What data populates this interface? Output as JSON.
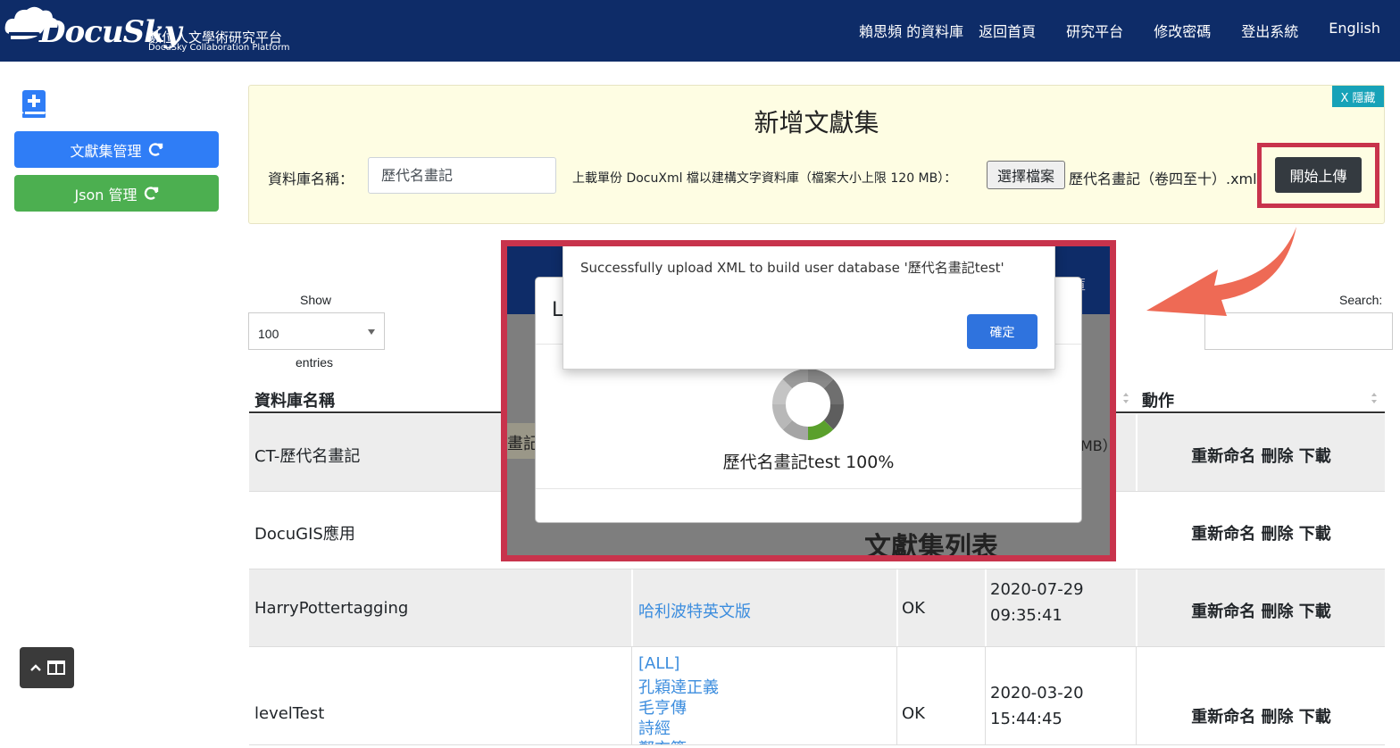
{
  "brand": {
    "logo_word": "DocuSky",
    "subtitle_cn": "數位人文學術研究平台",
    "subtitle_en": "DocuSky Collaboration Platform"
  },
  "nav": {
    "my_db": "賴思頻 的資料庫",
    "home": "返回首頁",
    "platform": "研究平台",
    "password": "修改密碼",
    "logout": "登出系統",
    "english": "English"
  },
  "sidebar": {
    "corpus_btn": "文獻集管理",
    "json_btn": "Json 管理"
  },
  "upload_panel": {
    "hide_label": "X 隱藏",
    "title": "新增文獻集",
    "db_label": "資料庫名稱：",
    "db_value": "歷代名畫記",
    "desc": "上載單份 DocuXml 檔以建構文字資料庫（檔案大小上限 120 MB）：",
    "choose_label": "選擇檔案",
    "file_name": "歷代名畫記（卷四至十）.xml",
    "start_label": "開始上傳"
  },
  "controls": {
    "show_label": "Show",
    "entries_value": "100",
    "entries_label": "entries",
    "search_label": "Search:"
  },
  "table": {
    "headers": {
      "name": "資料庫名稱",
      "action": "動作"
    },
    "action_labels": "重新命名 刪除 下載",
    "rows": [
      {
        "name": "CT-歷代名畫記"
      },
      {
        "name": "DocuGIS應用"
      },
      {
        "name": "HarryPottertagging",
        "corpus": "哈利波特英文版",
        "status": "OK",
        "date": "2020-07-29",
        "time": "09:35:41"
      },
      {
        "name": "levelTest",
        "corpus_list": [
          "[ALL]",
          "孔穎達正義",
          "毛亨傳",
          "詩經",
          "鄭玄箋"
        ],
        "status": "OK",
        "date": "2020-03-20",
        "time": "15:44:45"
      }
    ]
  },
  "overlay": {
    "navy_partial": "料庫",
    "behind_cell": "畫記",
    "behind_right": "MB）",
    "behind_title": "文獻集列表",
    "modal_title_partial": "L",
    "progress_text": "歷代名畫記test 100%",
    "progress_fraction": 1.0,
    "alert_message": "Successfully upload XML to build user database '歷代名畫記test'",
    "alert_ok": "確定"
  },
  "colors": {
    "navbar": "#0e2c68",
    "primary": "#2f7df6",
    "success": "#4caf50",
    "highlight": "#c8334c",
    "link": "#3c8dde",
    "arrow": "#ee6a55"
  }
}
